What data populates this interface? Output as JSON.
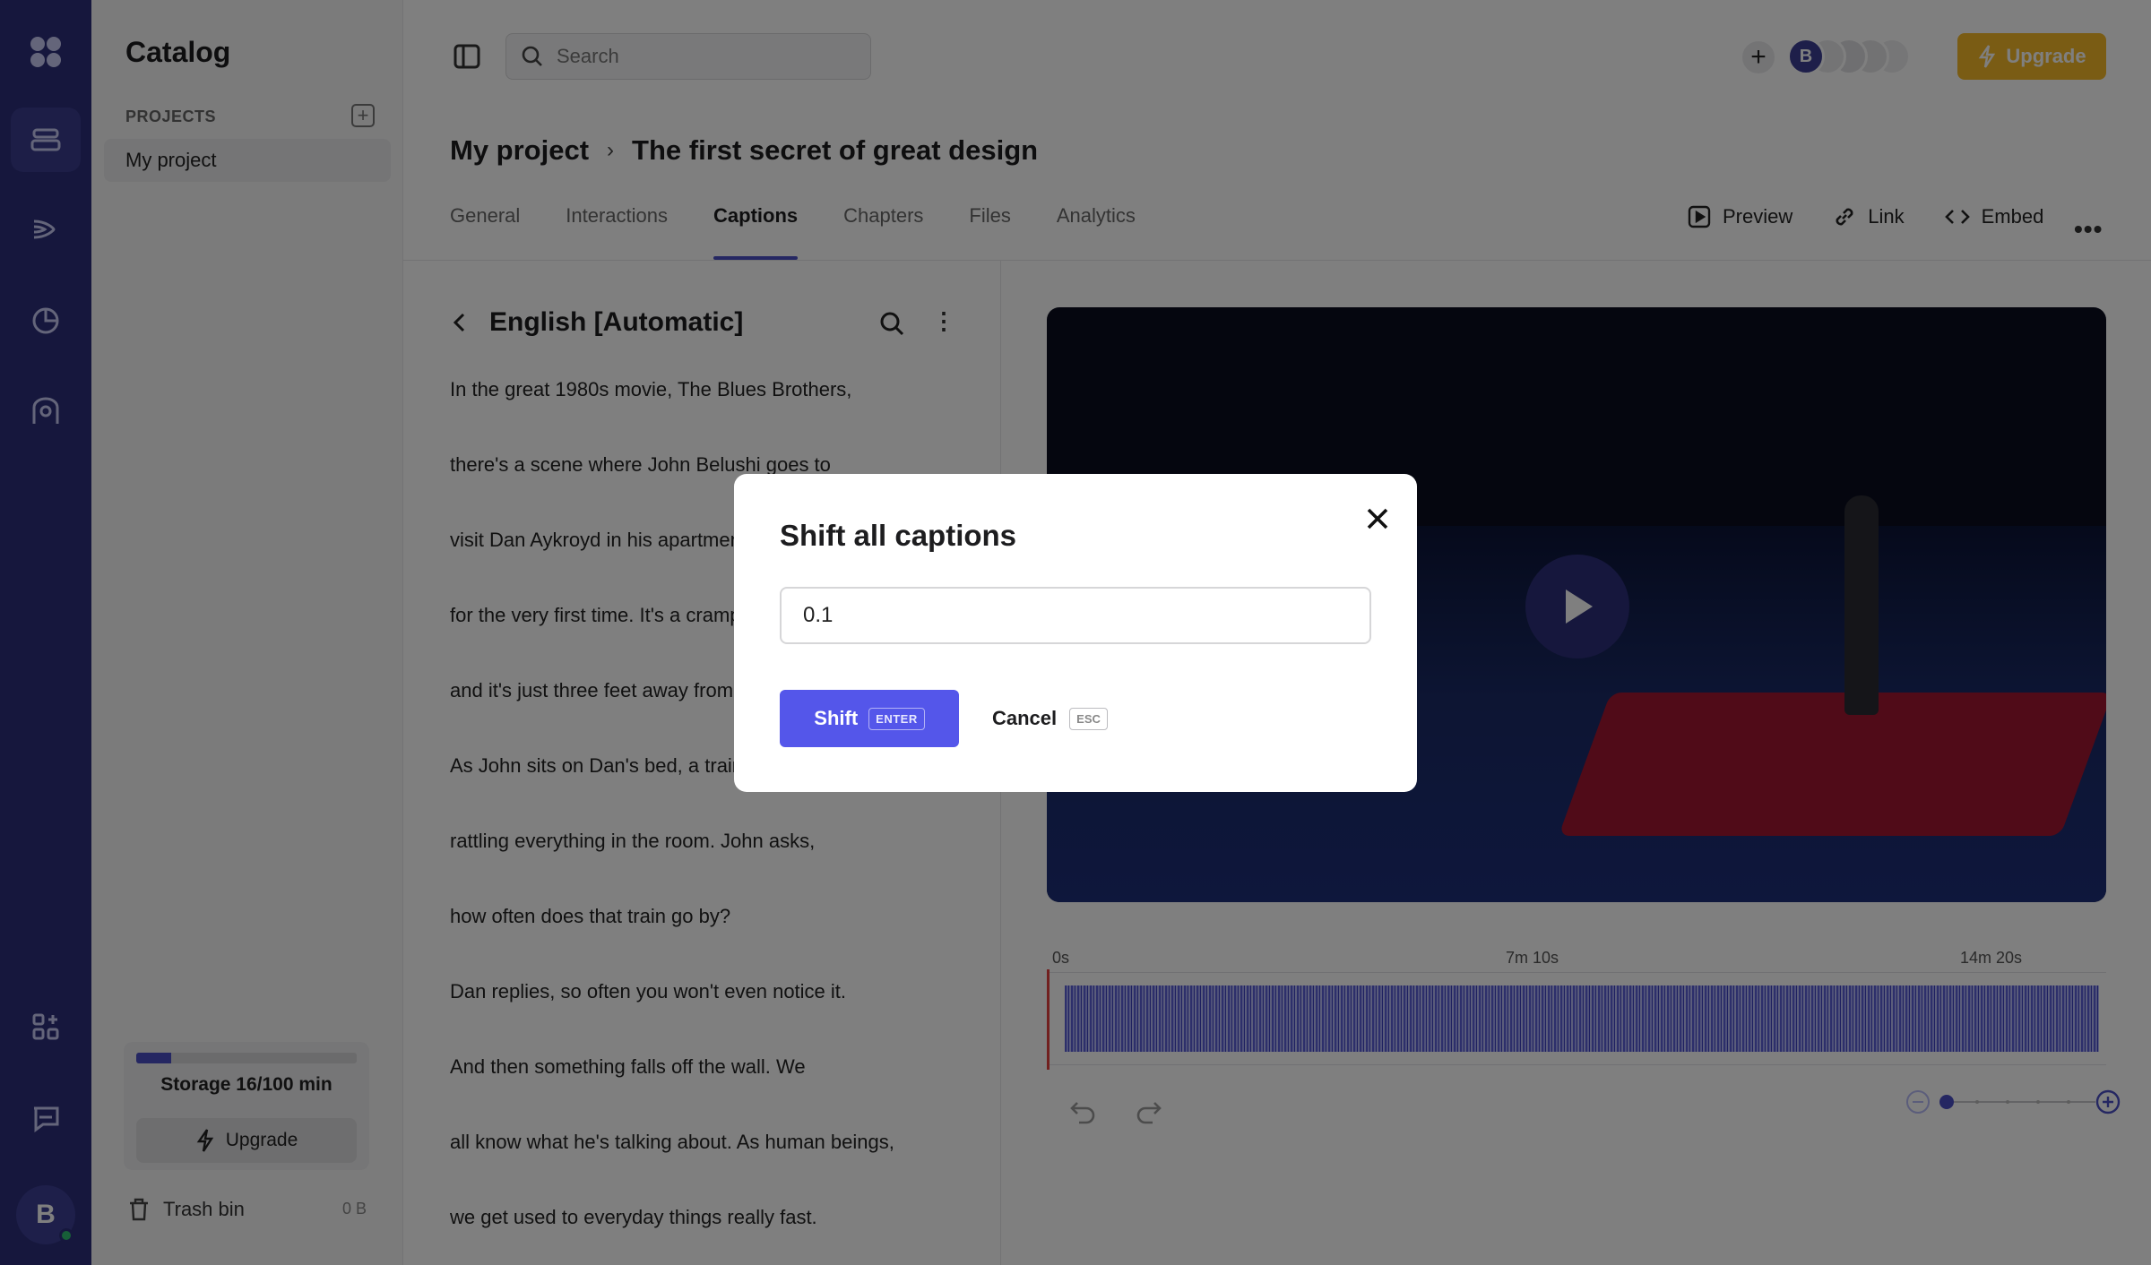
{
  "sidebar": {
    "title": "Catalog",
    "projects_label": "PROJECTS",
    "items": [
      {
        "label": "My project"
      }
    ],
    "storage": {
      "label": "Storage 16/100 min",
      "used_fraction": 0.16
    },
    "upgrade_label": "Upgrade",
    "trash_label": "Trash bin",
    "trash_size": "0 B"
  },
  "rail": {
    "avatar_initial": "B"
  },
  "topbar": {
    "search_placeholder": "Search",
    "collaborator_initial": "B",
    "upgrade_label": "Upgrade"
  },
  "breadcrumb": {
    "project": "My project",
    "title": "The first secret of great design"
  },
  "tabs": [
    {
      "label": "General"
    },
    {
      "label": "Interactions"
    },
    {
      "label": "Captions",
      "active": true
    },
    {
      "label": "Chapters"
    },
    {
      "label": "Files"
    },
    {
      "label": "Analytics"
    }
  ],
  "actions": {
    "preview": "Preview",
    "link": "Link",
    "embed": "Embed"
  },
  "transcript": {
    "title": "English [Automatic]",
    "lines": [
      "In the great 1980s movie, The Blues Brothers,",
      "there's a scene where John Belushi goes to",
      "visit Dan Aykroyd in his apartment",
      "for the very first time. It's a cramped",
      "and it's just three feet away from",
      "As John sits on Dan's bed, a train",
      "rattling everything in the room. John asks,",
      "how often does that train go by?",
      "Dan replies, so often you won't even notice it.",
      "And then something falls off the wall. We",
      "all know what he's talking about. As human beings,",
      "we get used to everyday things really fast."
    ]
  },
  "timeline": {
    "ticks": [
      "0s",
      "7m 10s",
      "14m 20s"
    ]
  },
  "modal": {
    "title": "Shift all captions",
    "input_value": "0.1",
    "shift_label": "Shift",
    "shift_key": "ENTER",
    "cancel_label": "Cancel",
    "cancel_key": "ESC"
  },
  "colors": {
    "rail": "#2d2f7a",
    "accent": "#5456ea",
    "upgrade": "#f5b928"
  }
}
